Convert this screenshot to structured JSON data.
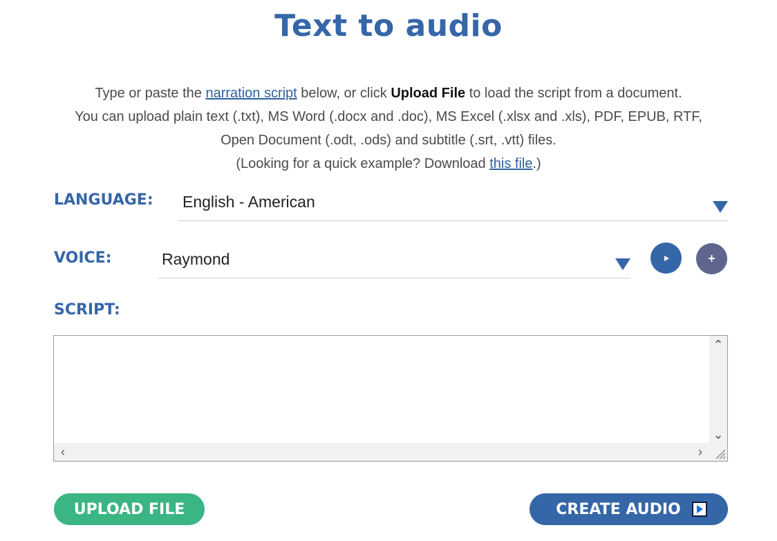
{
  "page": {
    "title": "Text to audio"
  },
  "intro": {
    "line1_pre": "Type or paste the ",
    "line1_link": "narration script",
    "line1_mid": " below, or click ",
    "line1_bold": "Upload File",
    "line1_post": " to load the script from a document.",
    "line2": "You can upload plain text (.txt), MS Word (.docx and .doc), MS Excel (.xlsx and .xls), PDF, EPUB, RTF,",
    "line3": "Open Document (.odt, .ods) and subtitle (.srt, .vtt) files.",
    "line4_pre": "(Looking for a quick example? Download ",
    "line4_link": "this file",
    "line4_post": ".)"
  },
  "language": {
    "label": "LANGUAGE:",
    "value": "English - American"
  },
  "voice": {
    "label": "VOICE:",
    "value": "Raymond",
    "add_symbol": "+"
  },
  "script": {
    "label": "SCRIPT:",
    "value": ""
  },
  "buttons": {
    "upload": "UPLOAD FILE",
    "create": "CREATE AUDIO"
  },
  "colors": {
    "accent": "#3566a8",
    "upload": "#3cb585",
    "add": "#5e6690"
  }
}
